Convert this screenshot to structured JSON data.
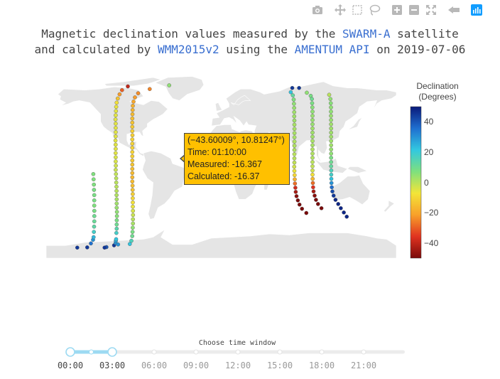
{
  "title": {
    "p1": "Magnetic declination values measured by the ",
    "l1": "SWARM-A",
    "p2": " satellite",
    "p3": "and calculated by ",
    "l2": "WMM2015v2",
    "p4": " using the ",
    "l3": "AMENTUM API",
    "p5": " on 2019-07-06"
  },
  "toolbar": {
    "items": [
      {
        "name": "camera-icon",
        "x": 13
      },
      {
        "name": "pan-icon",
        "x": 45
      },
      {
        "name": "box-select-icon",
        "x": 69
      },
      {
        "name": "lasso-select-icon",
        "x": 93
      },
      {
        "name": "zoom-in-icon",
        "x": 125
      },
      {
        "name": "zoom-out-icon",
        "x": 149
      },
      {
        "name": "autoscale-icon",
        "x": 173
      },
      {
        "name": "reset-view-icon",
        "x": 205
      },
      {
        "name": "plotly-logo-icon",
        "x": 237
      }
    ],
    "colors": {
      "icon": "#b8b8b8",
      "logo": "#119dff"
    }
  },
  "chart_data": {
    "type": "scattergeo",
    "projection": "equirectangular",
    "land_color": "#e5e5e5",
    "colorbar": {
      "title_line1": "Declination",
      "title_line2": "(Degrees)",
      "range": [
        -50,
        50
      ],
      "ticks": [
        40,
        20,
        0,
        -20,
        -40
      ],
      "colorscale": [
        "#0a1a7a",
        "#1f6fd0",
        "#32c8e0",
        "#7ee07e",
        "#f3e538",
        "#f8a02a",
        "#e03320",
        "#7a0a0a"
      ]
    },
    "series": [
      {
        "points": [
          [
            -137.8,
            -79.8,
            45
          ],
          [
            -134,
            -76,
            35
          ],
          [
            -131.8,
            -72.5,
            30
          ],
          [
            -131.2,
            -70,
            24
          ],
          [
            -130.9,
            -65,
            18
          ],
          [
            -130.7,
            -60,
            13
          ],
          [
            -130.5,
            -55,
            11
          ],
          [
            -130.5,
            -50,
            10
          ],
          [
            -130.5,
            -45,
            8
          ],
          [
            -130.6,
            -40,
            7
          ],
          [
            -130.6,
            -35,
            8
          ],
          [
            -130.6,
            -30,
            8
          ],
          [
            -130.8,
            -25,
            8
          ],
          [
            -130.9,
            -20,
            7
          ],
          [
            -131.2,
            -15,
            7
          ],
          [
            -131.5,
            -10,
            7
          ]
        ]
      },
      {
        "points": [
          [
            -110.2,
            -77.8,
            45
          ],
          [
            -108.6,
            -75.5,
            30
          ],
          [
            -108.4,
            -73.5,
            28
          ],
          [
            -108.1,
            -72,
            22
          ],
          [
            -107.8,
            -66,
            18
          ],
          [
            -107.5,
            -62,
            14
          ],
          [
            -107.5,
            -58,
            10
          ],
          [
            -107.4,
            -54,
            8
          ],
          [
            -107.3,
            -50,
            6
          ],
          [
            -107.3,
            -46,
            5
          ],
          [
            -107.5,
            -42,
            4
          ],
          [
            -107.5,
            -38,
            3
          ],
          [
            -107.5,
            -34,
            2
          ],
          [
            -107.6,
            -30,
            1
          ],
          [
            -107.6,
            -26,
            0
          ],
          [
            -107.7,
            -22,
            0
          ],
          [
            -107.9,
            -18,
            0
          ],
          [
            -108,
            -14,
            0
          ],
          [
            -108.2,
            -10,
            -1
          ],
          [
            -108.5,
            -6,
            -2
          ],
          [
            -108.4,
            -2,
            -3
          ],
          [
            -108.5,
            2,
            -4
          ],
          [
            -108.5,
            6,
            -4
          ],
          [
            -108.6,
            10,
            -5
          ],
          [
            -108.5,
            14,
            -5
          ],
          [
            -108.6,
            18,
            -5
          ],
          [
            -108.7,
            22,
            -5
          ],
          [
            -108.6,
            26,
            -5
          ],
          [
            -108.5,
            30,
            -5
          ],
          [
            -108.5,
            34,
            -5
          ],
          [
            -108.5,
            38,
            -5
          ],
          [
            -108.7,
            42,
            -5
          ],
          [
            -108.5,
            46,
            -5
          ],
          [
            -108.2,
            50,
            -5
          ],
          [
            -108,
            54,
            -6
          ],
          [
            -107.5,
            58,
            -8
          ],
          [
            -106.4,
            62,
            -14
          ],
          [
            -104.5,
            66,
            -22
          ],
          [
            -102,
            70,
            -30
          ],
          [
            -96,
            73.5,
            -40
          ]
        ]
      },
      {
        "points": [
          [
            -118,
            -79.5,
            40
          ],
          [
            -106,
            -77,
            30
          ],
          [
            -94,
            -76.5,
            22
          ],
          [
            -92.4,
            -73.5,
            16
          ],
          [
            -91.5,
            -69,
            10
          ],
          [
            -91.2,
            -65,
            8
          ],
          [
            -91,
            -61,
            5
          ],
          [
            -90.8,
            -57,
            2
          ],
          [
            -90.8,
            -53,
            0
          ],
          [
            -90.7,
            -49,
            -2
          ],
          [
            -90.8,
            -45,
            -4
          ],
          [
            -90.9,
            -41,
            -6
          ],
          [
            -90.9,
            -37,
            -8
          ],
          [
            -91,
            -33,
            -10
          ],
          [
            -91,
            -29,
            -12
          ],
          [
            -91.1,
            -25,
            -14
          ],
          [
            -91.2,
            -21,
            -15
          ],
          [
            -91.4,
            -17,
            -16
          ],
          [
            -91.4,
            -13,
            -16.4
          ],
          [
            -91.4,
            -9,
            -16
          ],
          [
            -91.4,
            -5,
            -15
          ],
          [
            -91.4,
            -1,
            -14
          ],
          [
            -91.4,
            3,
            -13
          ],
          [
            -91.4,
            7,
            -12
          ],
          [
            -91.4,
            11,
            -11
          ],
          [
            -91.4,
            15,
            -11
          ],
          [
            -91.4,
            19,
            -11
          ],
          [
            -91.4,
            23,
            -11
          ],
          [
            -91.3,
            27,
            -12
          ],
          [
            -91.4,
            31,
            -12
          ],
          [
            -91.4,
            35,
            -13
          ],
          [
            -91.4,
            39,
            -14
          ],
          [
            -91.4,
            43,
            -15
          ],
          [
            -91.3,
            47,
            -16
          ],
          [
            -91.1,
            51,
            -17
          ],
          [
            -90.9,
            55,
            -18
          ],
          [
            -90.2,
            59,
            -20
          ],
          [
            -88.7,
            63,
            -22
          ],
          [
            -85.4,
            67,
            -24
          ],
          [
            -73.5,
            71,
            -25
          ],
          [
            -53.5,
            74.5,
            5
          ]
        ]
      },
      {
        "points": [
          [
            73,
            72,
            45
          ],
          [
            80,
            72,
            45
          ],
          [
            71.5,
            68,
            22
          ],
          [
            73.6,
            65,
            12
          ],
          [
            74.5,
            61,
            7
          ],
          [
            74.8,
            57,
            5
          ],
          [
            75,
            53,
            4
          ],
          [
            75.1,
            49,
            3
          ],
          [
            75.1,
            45,
            3
          ],
          [
            75.2,
            41,
            3
          ],
          [
            75.2,
            37,
            2
          ],
          [
            75.3,
            33,
            2
          ],
          [
            75.3,
            29,
            2
          ],
          [
            75.3,
            25,
            2
          ],
          [
            75.3,
            21,
            1
          ],
          [
            75.3,
            17,
            1
          ],
          [
            75.2,
            13,
            1
          ],
          [
            75.2,
            9,
            0
          ],
          [
            75.2,
            5,
            0
          ],
          [
            75.2,
            1,
            -1
          ],
          [
            75.1,
            -3,
            -3
          ],
          [
            75.2,
            -7,
            -6
          ],
          [
            75.4,
            -11,
            -10
          ],
          [
            75.6,
            -15,
            -18
          ],
          [
            75.8,
            -19,
            -28
          ],
          [
            76.2,
            -23,
            -38
          ],
          [
            76.6,
            -27,
            -44
          ],
          [
            77.4,
            -31,
            -48
          ],
          [
            78.8,
            -35,
            -50
          ],
          [
            80.5,
            -39,
            -52
          ],
          [
            83,
            -43,
            -52
          ],
          [
            87.5,
            -47,
            -50
          ]
        ]
      },
      {
        "points": [
          [
            88,
            67.5,
            5
          ],
          [
            92,
            64.5,
            8
          ],
          [
            93.2,
            61.5,
            10
          ],
          [
            93.5,
            57.5,
            8
          ],
          [
            93.7,
            53.5,
            6
          ],
          [
            93.8,
            49.5,
            5
          ],
          [
            93.8,
            45.5,
            4
          ],
          [
            93.8,
            41.5,
            4
          ],
          [
            93.8,
            37.5,
            4
          ],
          [
            93.8,
            33.5,
            3
          ],
          [
            93.8,
            29.5,
            3
          ],
          [
            93.8,
            25.5,
            3
          ],
          [
            93.8,
            21.5,
            2
          ],
          [
            93.8,
            17.5,
            2
          ],
          [
            93.8,
            13.5,
            1
          ],
          [
            93.8,
            9.5,
            1
          ],
          [
            93.8,
            5.5,
            1
          ],
          [
            93.8,
            1.5,
            0
          ],
          [
            93.8,
            -2.5,
            -1
          ],
          [
            93.8,
            -6.5,
            -3
          ],
          [
            93.8,
            -10.5,
            -8
          ],
          [
            94,
            -14.5,
            -16
          ],
          [
            94.2,
            -18.5,
            -28
          ],
          [
            94.5,
            -22.5,
            -36
          ],
          [
            94.9,
            -26.5,
            -44
          ],
          [
            96,
            -30.5,
            -48
          ],
          [
            97.4,
            -34.5,
            -50
          ],
          [
            99.5,
            -38.5,
            -50
          ],
          [
            103,
            -42.5,
            -50
          ]
        ]
      },
      {
        "points": [
          [
            111,
            65.5,
            0
          ],
          [
            112.2,
            61.5,
            5
          ],
          [
            112.6,
            57.5,
            6
          ],
          [
            112.8,
            53.5,
            5
          ],
          [
            112.8,
            49.5,
            5
          ],
          [
            112.8,
            45.5,
            4
          ],
          [
            112.9,
            41.5,
            4
          ],
          [
            112.9,
            37.5,
            3
          ],
          [
            113,
            33.5,
            3
          ],
          [
            113,
            29.5,
            3
          ],
          [
            113,
            25.5,
            3
          ],
          [
            113,
            21.5,
            3
          ],
          [
            113,
            17.5,
            3
          ],
          [
            113,
            13.5,
            4
          ],
          [
            113,
            9.5,
            5
          ],
          [
            113,
            5.5,
            8
          ],
          [
            113,
            1.5,
            10
          ],
          [
            113,
            -2.5,
            12
          ],
          [
            113.1,
            -6.5,
            16
          ],
          [
            113.1,
            -10.5,
            18
          ],
          [
            113.2,
            -14.5,
            22
          ],
          [
            113.3,
            -18.5,
            30
          ],
          [
            113.6,
            -22.5,
            36
          ],
          [
            114.3,
            -26.5,
            42
          ],
          [
            115.5,
            -30.5,
            45
          ],
          [
            117.5,
            -34.5,
            48
          ],
          [
            120.3,
            -38.5,
            48
          ],
          [
            123,
            -42.5,
            48
          ],
          [
            126,
            -46.5,
            48
          ],
          [
            129,
            -50.5,
            48
          ]
        ]
      },
      {
        "points": [
          [
            -148,
            -80,
            45
          ],
          [
            -120,
            -80,
            45
          ]
        ]
      }
    ],
    "slider": {
      "label": "Choose time window",
      "ticks": [
        "00:00",
        "03:00",
        "06:00",
        "09:00",
        "12:00",
        "15:00",
        "18:00",
        "21:00"
      ],
      "active": [
        0,
        1
      ],
      "dots": [
        0,
        0.5,
        1,
        2,
        3,
        4,
        5,
        6,
        7
      ]
    }
  },
  "tooltip": {
    "line1": "(−43.60009°, 10.81247°)",
    "line2": "Time: 01:10:00",
    "line3": "Measured: -16.367",
    "line4": "Calculated: -16.37"
  }
}
